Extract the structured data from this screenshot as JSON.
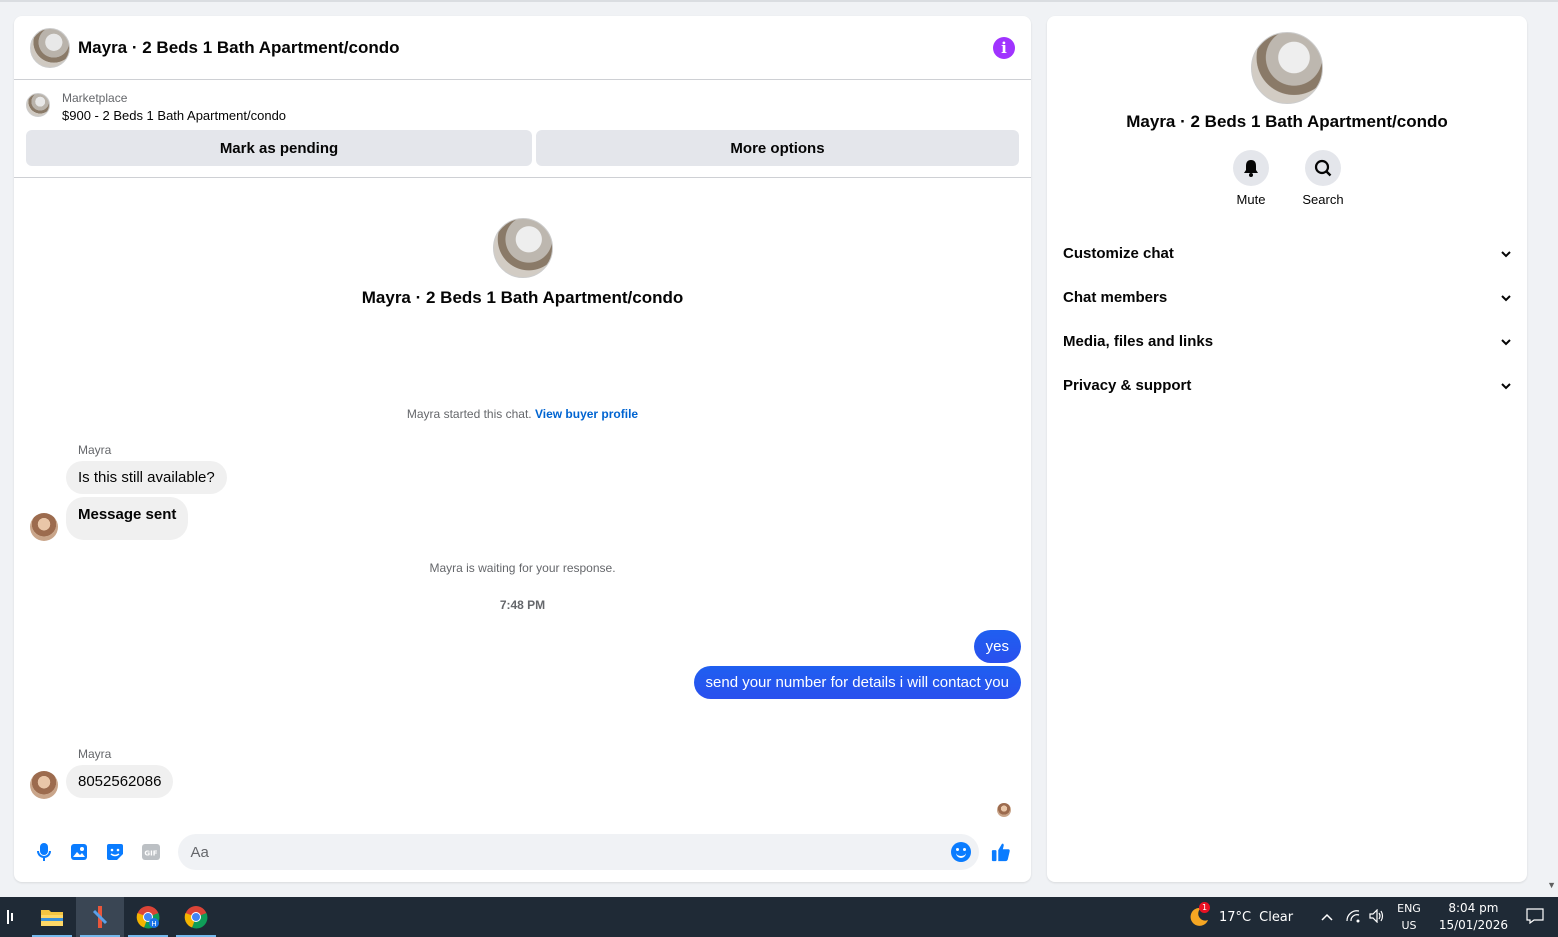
{
  "header": {
    "title": "Mayra · 2 Beds 1 Bath Apartment/condo"
  },
  "marketplace": {
    "label": "Marketplace",
    "listing": "$900 - 2 Beds 1 Bath Apartment/condo",
    "mark_pending": "Mark as pending",
    "more_options": "More options"
  },
  "conversation": {
    "name": "Mayra · 2 Beds 1 Bath Apartment/condo",
    "started_text": "Mayra started this chat.",
    "view_buyer_profile": "View buyer profile",
    "sender1": "Mayra",
    "msg1": "Is this still available?",
    "msg2": "Message sent",
    "waiting": "Mayra is waiting for your response.",
    "time": "7:48 PM",
    "out1": "yes",
    "out2": "send your number for details i will contact you",
    "sender2": "Mayra",
    "msg3": "8052562086"
  },
  "composer": {
    "placeholder": "Aa"
  },
  "side": {
    "name": "Mayra · 2 Beds 1 Bath Apartment/condo",
    "mute": "Mute",
    "search": "Search",
    "items": [
      {
        "label": "Customize chat"
      },
      {
        "label": "Chat members"
      },
      {
        "label": "Media, files and links"
      },
      {
        "label": "Privacy & support"
      }
    ]
  },
  "taskbar": {
    "weather_temp": "17°C",
    "weather_text": "Clear",
    "weather_badge": "1",
    "lang1": "ENG",
    "lang2": "US",
    "time": "8:04 pm",
    "date": "15/01/2026"
  },
  "colors": {
    "accent": "#0a7cff",
    "info": "#a033ff",
    "outgoing": "#1f5ff0"
  }
}
